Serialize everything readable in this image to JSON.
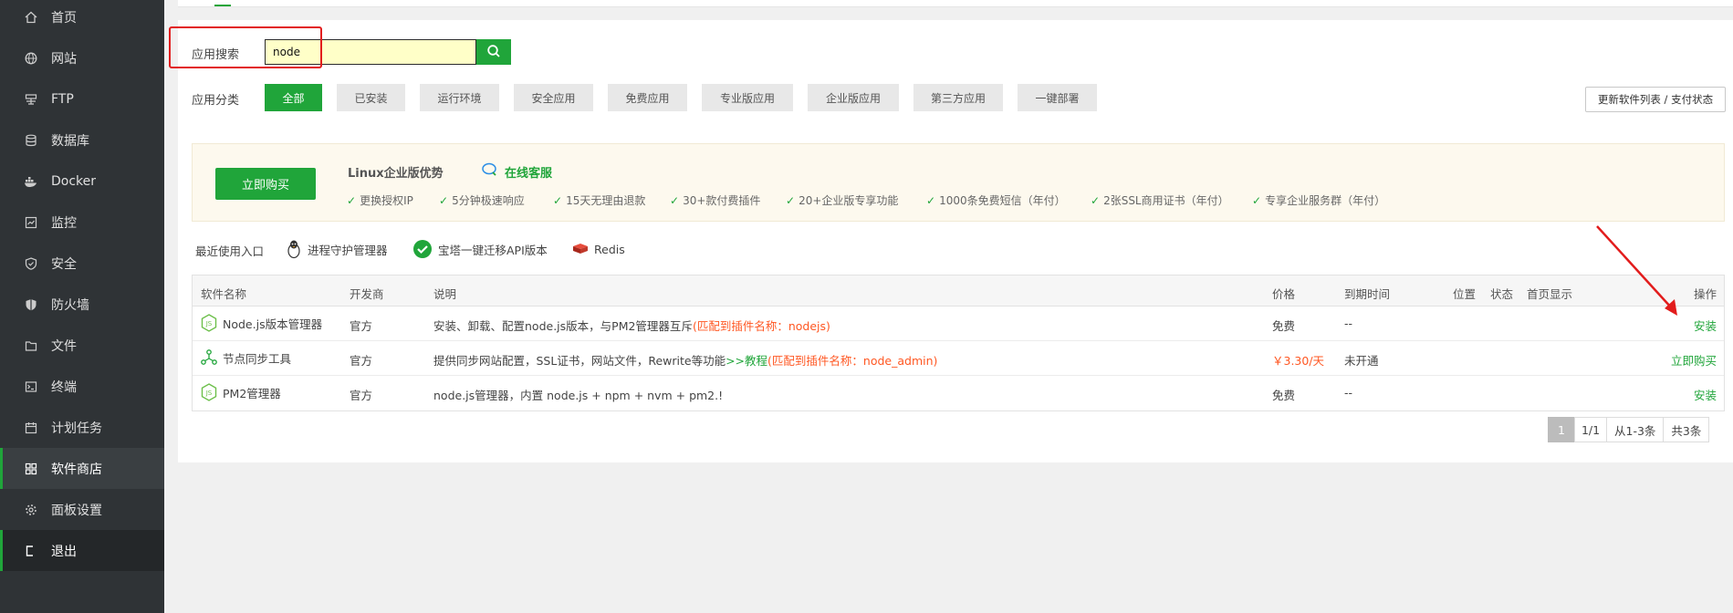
{
  "sidebar": {
    "items": [
      {
        "label": "首页",
        "icon": "home-icon"
      },
      {
        "label": "网站",
        "icon": "globe-icon"
      },
      {
        "label": "FTP",
        "icon": "ftp-icon"
      },
      {
        "label": "数据库",
        "icon": "database-icon"
      },
      {
        "label": "Docker",
        "icon": "docker-icon"
      },
      {
        "label": "监控",
        "icon": "monitor-icon"
      },
      {
        "label": "安全",
        "icon": "shield-icon"
      },
      {
        "label": "防火墙",
        "icon": "firewall-icon"
      },
      {
        "label": "文件",
        "icon": "folder-icon"
      },
      {
        "label": "终端",
        "icon": "terminal-icon"
      },
      {
        "label": "计划任务",
        "icon": "calendar-icon"
      },
      {
        "label": "软件商店",
        "icon": "apps-icon"
      },
      {
        "label": "面板设置",
        "icon": "gear-icon"
      },
      {
        "label": "退出",
        "icon": "logout-icon"
      }
    ],
    "active": "软件商店"
  },
  "search": {
    "label": "应用搜索",
    "value": "node"
  },
  "categories": {
    "label": "应用分类",
    "items": [
      "全部",
      "已安装",
      "运行环境",
      "安全应用",
      "免费应用",
      "专业版应用",
      "企业版应用",
      "第三方应用",
      "一键部署"
    ],
    "active": "全部"
  },
  "update_button": "更新软件列表 / 支付状态",
  "promo": {
    "buy_button": "立即购买",
    "title": "Linux企业版优势",
    "service": "在线客服",
    "features": [
      "更换授权IP",
      "5分钟极速响应",
      "15天无理由退款",
      "30+款付费插件",
      "20+企业版专享功能",
      "1000条免费短信（年付）",
      "2张SSL商用证书（年付）",
      "专享企业服务群（年付）"
    ]
  },
  "recent": {
    "label": "最近使用入口",
    "items": [
      "进程守护管理器",
      "宝塔一键迁移API版本",
      "Redis"
    ]
  },
  "table": {
    "headers": {
      "name": "软件名称",
      "developer": "开发商",
      "desc": "说明",
      "price": "价格",
      "expire": "到期时间",
      "position": "位置",
      "status": "状态",
      "homepage": "首页显示",
      "action": "操作"
    },
    "rows": [
      {
        "name": "Node.js版本管理器",
        "developer": "官方",
        "desc": "安装、卸载、配置node.js版本，与PM2管理器互斥",
        "desc_extra": "(匹配到插件名称：nodejs)",
        "tutorial": "",
        "price": "免费",
        "expire": "--",
        "action": "安装"
      },
      {
        "name": "节点同步工具",
        "developer": "官方",
        "desc": "提供同步网站配置，SSL证书，网站文件，Rewrite等功能",
        "tutorial": ">>教程",
        "desc_extra": "(匹配到插件名称：node_admin)",
        "price": "￥3.30/天",
        "expire": "未开通",
        "action": "立即购买"
      },
      {
        "name": "PM2管理器",
        "developer": "官方",
        "desc": "node.js管理器，内置 node.js + npm + nvm + pm2.!",
        "desc_extra": "",
        "tutorial": "",
        "price": "免费",
        "expire": "--",
        "action": "安装"
      }
    ]
  },
  "pagination": {
    "current": "1",
    "pages": "1/1",
    "range": "从1-3条",
    "total": "共3条"
  },
  "colors": {
    "accent": "#20a53a",
    "sidebar_bg": "#2f3336",
    "highlight_red": "#e21c1c",
    "orange_text": "#ff5722"
  }
}
